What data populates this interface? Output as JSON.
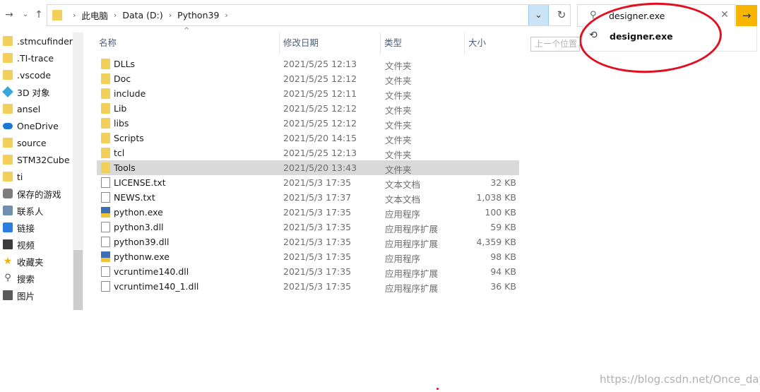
{
  "address": {
    "crumbs": [
      "此电脑",
      "Data (D:)",
      "Python39"
    ]
  },
  "search": {
    "value": "designer.exe",
    "suggestion": "designer.exe"
  },
  "sidebar": {
    "items": [
      {
        "label": ".stmcufinder",
        "icon": "folder-icon"
      },
      {
        "label": ".TI-trace",
        "icon": "folder-icon"
      },
      {
        "label": ".vscode",
        "icon": "folder-icon"
      },
      {
        "label": "3D 对象",
        "icon": "3d-objects-icon"
      },
      {
        "label": "ansel",
        "icon": "folder-icon"
      },
      {
        "label": "OneDrive",
        "icon": "onedrive-icon"
      },
      {
        "label": "source",
        "icon": "folder-icon"
      },
      {
        "label": "STM32Cube",
        "icon": "folder-icon"
      },
      {
        "label": "ti",
        "icon": "folder-icon"
      },
      {
        "label": "保存的游戏",
        "icon": "saved-games-icon"
      },
      {
        "label": "联系人",
        "icon": "contacts-icon"
      },
      {
        "label": "链接",
        "icon": "links-icon"
      },
      {
        "label": "视频",
        "icon": "videos-icon"
      },
      {
        "label": "收藏夹",
        "icon": "favorites-icon"
      },
      {
        "label": "搜索",
        "icon": "searches-icon"
      },
      {
        "label": "图片",
        "icon": "pictures-icon"
      }
    ]
  },
  "columns": {
    "name": "名称",
    "date": "修改日期",
    "type": "类型",
    "size": "大小"
  },
  "tooltip": "上一个位置",
  "files": [
    {
      "name": "DLLs",
      "date": "2021/5/25 12:13",
      "type": "文件夹",
      "size": "",
      "icon": "folder"
    },
    {
      "name": "Doc",
      "date": "2021/5/25 12:12",
      "type": "文件夹",
      "size": "",
      "icon": "folder"
    },
    {
      "name": "include",
      "date": "2021/5/25 12:11",
      "type": "文件夹",
      "size": "",
      "icon": "folder"
    },
    {
      "name": "Lib",
      "date": "2021/5/25 12:12",
      "type": "文件夹",
      "size": "",
      "icon": "folder"
    },
    {
      "name": "libs",
      "date": "2021/5/25 12:12",
      "type": "文件夹",
      "size": "",
      "icon": "folder"
    },
    {
      "name": "Scripts",
      "date": "2021/5/20 14:15",
      "type": "文件夹",
      "size": "",
      "icon": "folder"
    },
    {
      "name": "tcl",
      "date": "2021/5/25 12:13",
      "type": "文件夹",
      "size": "",
      "icon": "folder"
    },
    {
      "name": "Tools",
      "date": "2021/5/20 13:43",
      "type": "文件夹",
      "size": "",
      "icon": "folder",
      "selected": true
    },
    {
      "name": "LICENSE.txt",
      "date": "2021/5/3 17:35",
      "type": "文本文档",
      "size": "32 KB",
      "icon": "txt"
    },
    {
      "name": "NEWS.txt",
      "date": "2021/5/3 17:37",
      "type": "文本文档",
      "size": "1,038 KB",
      "icon": "txt"
    },
    {
      "name": "python.exe",
      "date": "2021/5/3 17:35",
      "type": "应用程序",
      "size": "100 KB",
      "icon": "exe"
    },
    {
      "name": "python3.dll",
      "date": "2021/5/3 17:35",
      "type": "应用程序扩展",
      "size": "59 KB",
      "icon": "dll"
    },
    {
      "name": "python39.dll",
      "date": "2021/5/3 17:35",
      "type": "应用程序扩展",
      "size": "4,359 KB",
      "icon": "dll"
    },
    {
      "name": "pythonw.exe",
      "date": "2021/5/3 17:35",
      "type": "应用程序",
      "size": "98 KB",
      "icon": "exe"
    },
    {
      "name": "vcruntime140.dll",
      "date": "2021/5/3 17:35",
      "type": "应用程序扩展",
      "size": "94 KB",
      "icon": "dll"
    },
    {
      "name": "vcruntime140_1.dll",
      "date": "2021/5/3 17:35",
      "type": "应用程序扩展",
      "size": "36 KB",
      "icon": "dll"
    }
  ],
  "watermark": "https://blog.csdn.net/Once_day",
  "colors": {
    "annotation_red": "#e01020",
    "go_button": "#f7b500",
    "selection": "#d9d9d9",
    "folder": "#f3cf5b"
  }
}
